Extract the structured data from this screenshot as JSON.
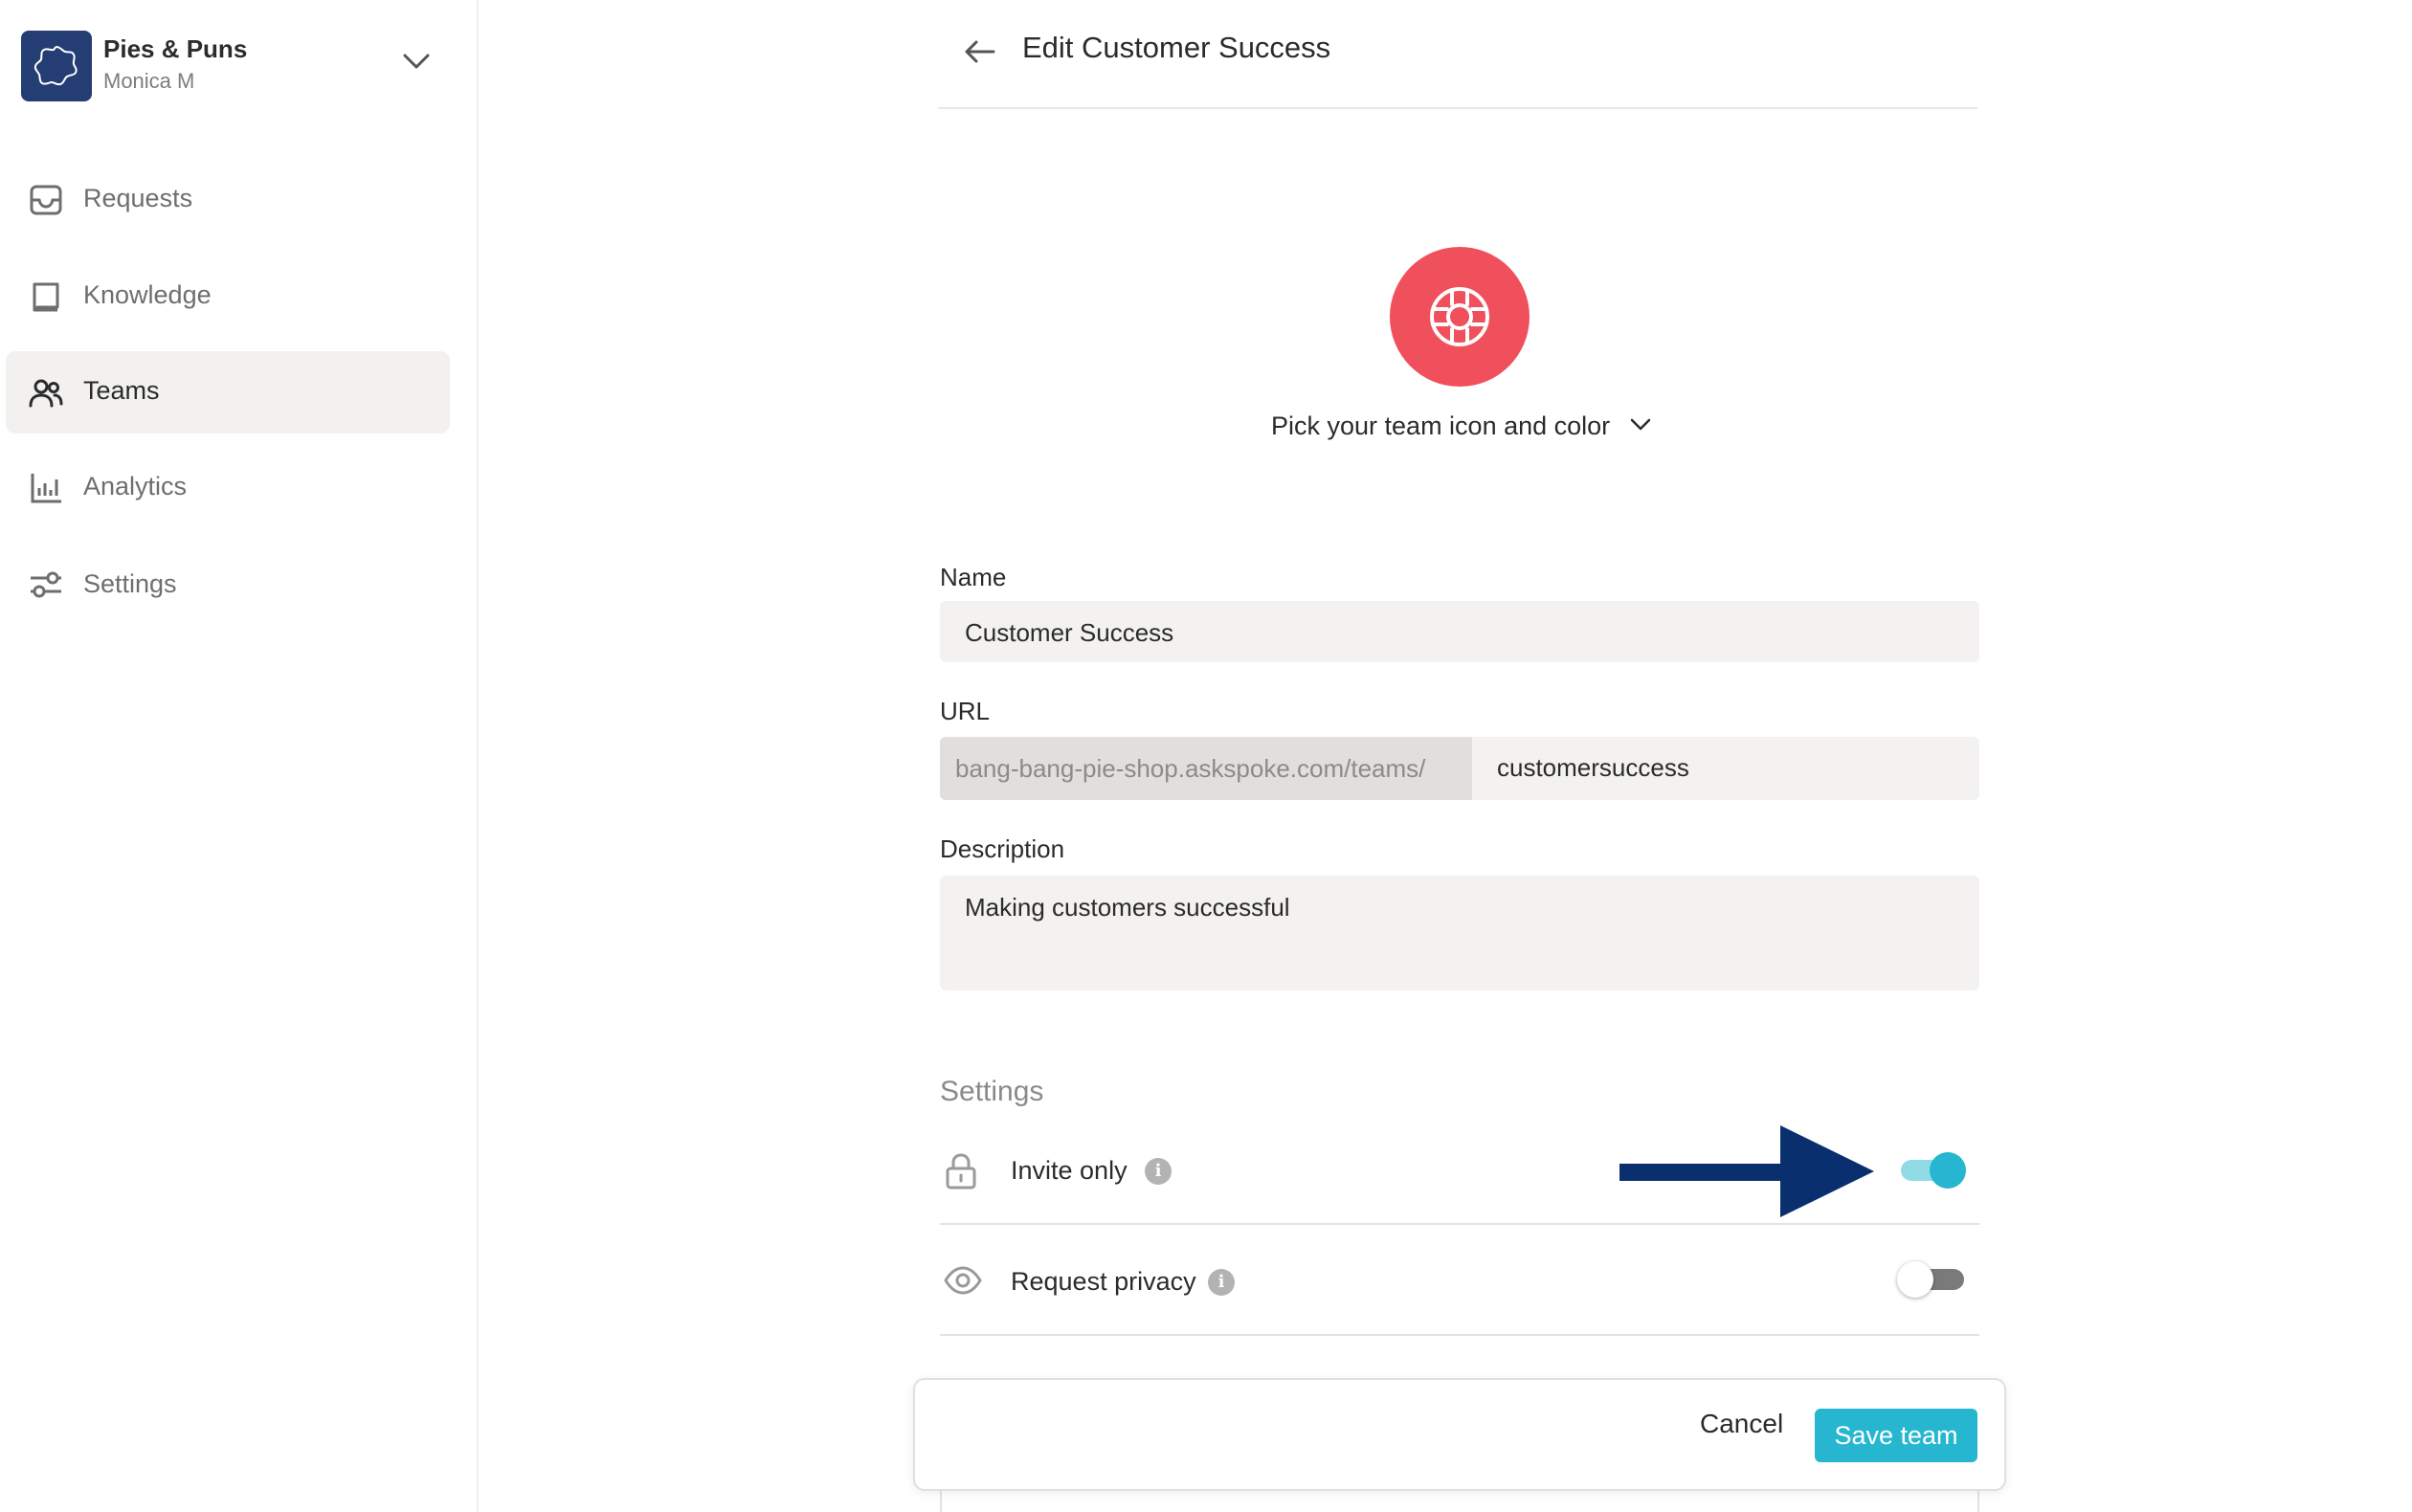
{
  "sidebar": {
    "org_name": "Pies & Puns",
    "user_name": "Monica M",
    "items": [
      {
        "label": "Requests",
        "icon": "inbox-icon",
        "active": false
      },
      {
        "label": "Knowledge",
        "icon": "book-icon",
        "active": false
      },
      {
        "label": "Teams",
        "icon": "people-icon",
        "active": true
      },
      {
        "label": "Analytics",
        "icon": "bar-chart-icon",
        "active": false
      },
      {
        "label": "Settings",
        "icon": "sliders-icon",
        "active": false
      }
    ]
  },
  "header": {
    "title": "Edit Customer Success"
  },
  "team_icon": {
    "color": "#f0505c",
    "icon": "lifebuoy-icon",
    "picker_label": "Pick your team icon and color"
  },
  "form": {
    "name_label": "Name",
    "name_value": "Customer Success",
    "url_label": "URL",
    "url_prefix": "bang-bang-pie-shop.askspoke.com/teams/",
    "url_value": "customersuccess",
    "description_label": "Description",
    "description_value": "Making customers successful"
  },
  "settings": {
    "heading": "Settings",
    "invite_only": {
      "label": "Invite only",
      "enabled": true
    },
    "request_privacy": {
      "label": "Request privacy",
      "enabled": false
    }
  },
  "actions": {
    "cancel_label": "Cancel",
    "save_label": "Save team"
  },
  "colors": {
    "accent": "#27b6d0",
    "team_icon": "#f0505c",
    "annotation_arrow": "#0a2f6e",
    "org_logo": "#243e73"
  }
}
